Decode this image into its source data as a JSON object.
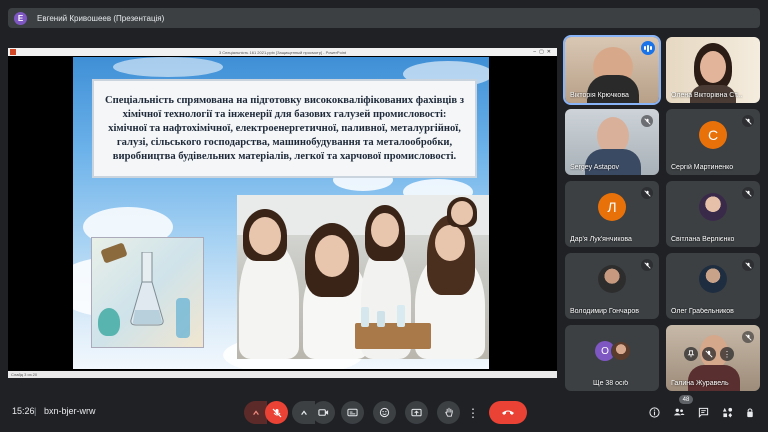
{
  "presenter_bar": {
    "avatar_letter": "E",
    "avatar_color": "#7e57c2",
    "text": "Евгений Кривошеев (Презентація)"
  },
  "presentation": {
    "window_title": "3 Спеціальність 161 2021.pptx [Защищенный просмотр] - PowerPoint",
    "status_text": "Слайд 3 из 20",
    "slide_text": "Спеціальність спрямована на підготовку висококваліфікованих фахівців з хімічної технології та інженерії для базових галузей промисловості: хімічної та нафтохімічної, електроенергетичної, паливної, металургійної, галузі, сільського господарства, машинобудування та металообробки, виробництва будівельних матеріалів, легкої та харчової промисловості."
  },
  "participants": [
    {
      "name": "Вікторія Крючкова",
      "type": "video",
      "speaking": true
    },
    {
      "name": "Олена Вікторівна Ст...",
      "type": "video",
      "muted": false
    },
    {
      "name": "Sergey Astapov",
      "type": "video",
      "muted": true
    },
    {
      "name": "Сергій Мартиненко",
      "type": "letter",
      "letter": "С",
      "color": "#e8710a",
      "muted": true
    },
    {
      "name": "Дар'я Лук'янчикова",
      "type": "letter",
      "letter": "Л",
      "color": "#e8710a",
      "muted": true
    },
    {
      "name": "Світлана Верлієнко",
      "type": "photo",
      "muted": true
    },
    {
      "name": "Володимир Гончаров",
      "type": "photo",
      "muted": true
    },
    {
      "name": "Олег Грабельников",
      "type": "photo",
      "muted": true
    },
    {
      "name": "Ще 38 осіб",
      "type": "more",
      "letter": "О",
      "color": "#7e57c2"
    },
    {
      "name": "Галина Журавель",
      "type": "video",
      "muted": true
    }
  ],
  "bottom": {
    "time": "15:26",
    "separator": "|",
    "meeting_code": "bxn-bjer-wrw",
    "participant_count": "48"
  },
  "colors": {
    "background": "#202124",
    "tile": "#3c4043",
    "accent": "#8ab4f8",
    "end_call": "#ea4335"
  }
}
